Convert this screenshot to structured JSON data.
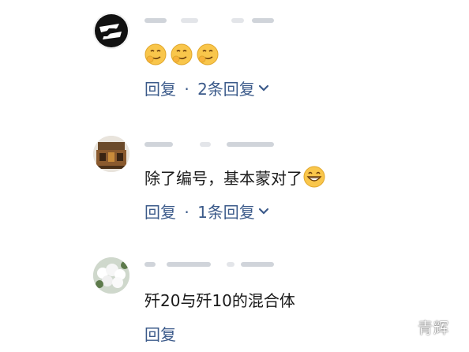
{
  "comments": [
    {
      "emoji_count": 3,
      "reply_label": "回复",
      "separator": "·",
      "replies_label": "2条回复"
    },
    {
      "text": "除了编号，基本蒙对了",
      "reply_label": "回复",
      "separator": "·",
      "replies_label": "1条回复"
    },
    {
      "text": "歼20与歼10的混合体",
      "reply_label": "回复"
    }
  ],
  "watermark": "青辉",
  "colors": {
    "reply": "#3b5a8a",
    "text": "#1a1a1a",
    "emoji_face": "#f9c64b",
    "blurred_name": "#c8ccd3"
  },
  "icons": [
    "smirk-emoji-icon",
    "grin-emoji-icon",
    "chevron-down-icon"
  ]
}
